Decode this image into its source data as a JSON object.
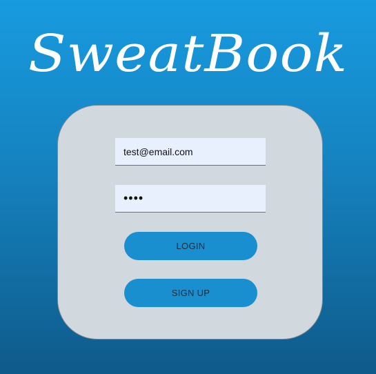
{
  "app": {
    "title": "SweatBook"
  },
  "login_form": {
    "email_value": "test@email.com",
    "password_value": "••••",
    "login_label": "LOGIN",
    "signup_label": "SIGN UP"
  },
  "colors": {
    "background_top": "#189be0",
    "background_bottom": "#0f5a8a",
    "card_background": "#d2d9de",
    "field_background": "#e8f0fe",
    "button_background": "#1a8fd0"
  }
}
